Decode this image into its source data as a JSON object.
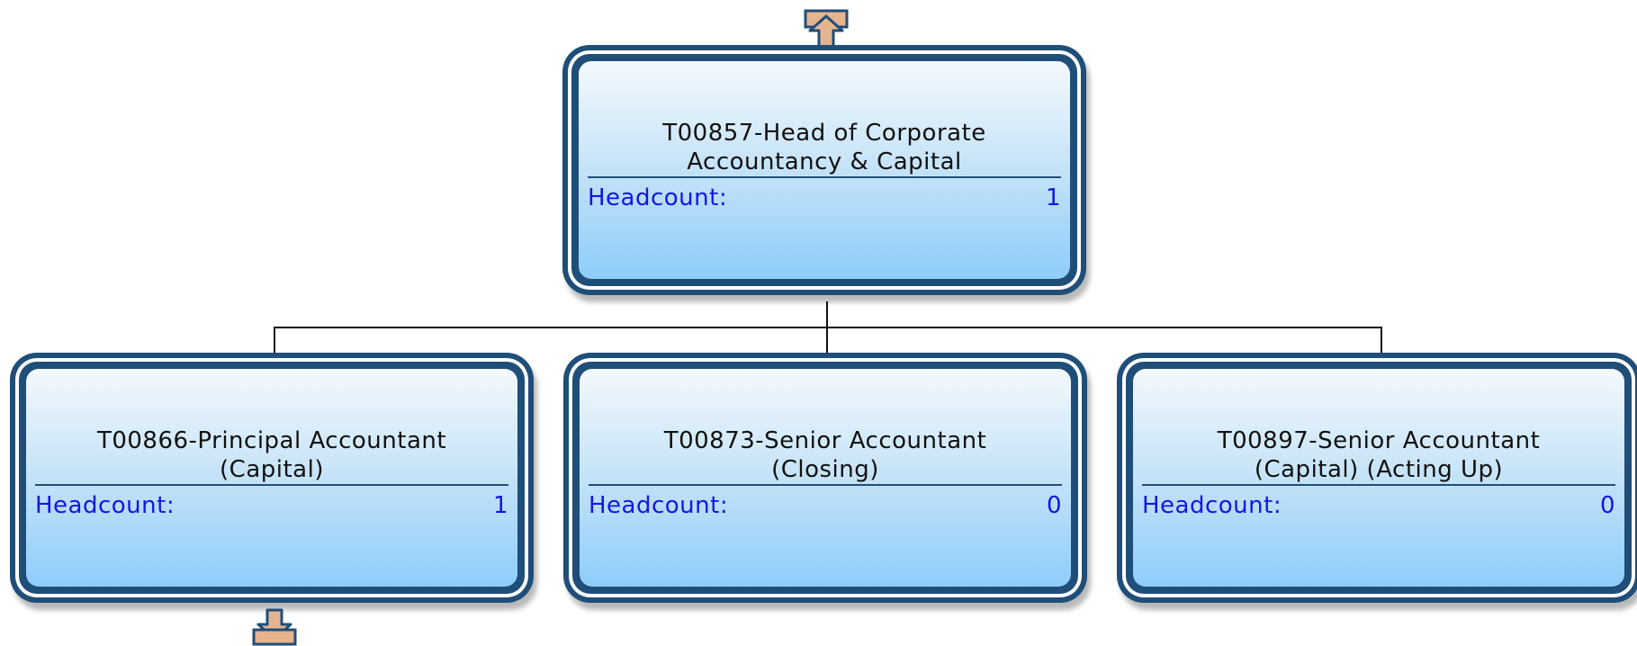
{
  "colors": {
    "border": "#1f4e79",
    "fill_top": "#f4f9fd",
    "fill_bottom": "#8fcdfb",
    "label_text": "#1515e6",
    "title_text": "#111111",
    "arrow_fill": "#e5b48e",
    "connector": "#111111"
  },
  "root": {
    "title": "T00857-Head of Corporate\nAccountancy & Capital",
    "headcount_label": "Headcount:",
    "headcount_value": "1"
  },
  "children": [
    {
      "title": "T00866-Principal Accountant\n(Capital)",
      "headcount_label": "Headcount:",
      "headcount_value": "1"
    },
    {
      "title": "T00873-Senior Accountant\n(Closing)",
      "headcount_label": "Headcount:",
      "headcount_value": "0"
    },
    {
      "title": "T00897-Senior Accountant\n(Capital) (Acting Up)",
      "headcount_label": "Headcount:",
      "headcount_value": "0"
    }
  ],
  "icons": {
    "expand_up": "expand-up-arrow-icon",
    "expand_down": "expand-down-arrow-icon"
  }
}
